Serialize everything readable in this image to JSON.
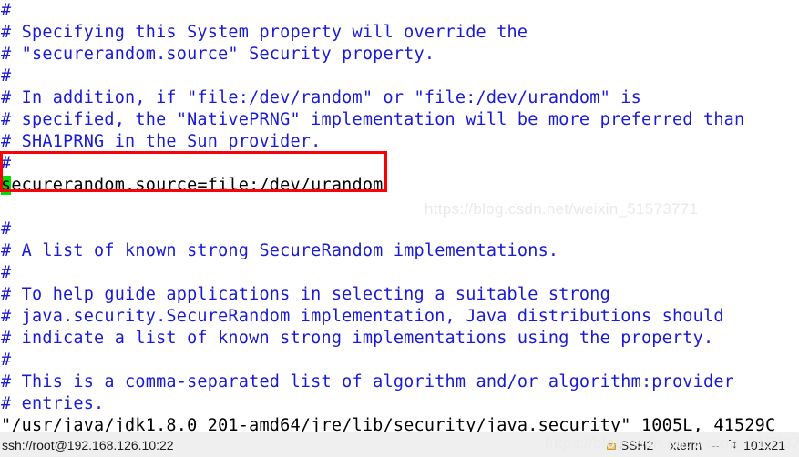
{
  "window": {
    "title": "ssh://root@192.168.126.10:22"
  },
  "terminal": {
    "lines": [
      {
        "type": "comment",
        "text": "#"
      },
      {
        "type": "comment",
        "text": "# Specifying this System property will override the"
      },
      {
        "type": "comment",
        "text": "# \"securerandom.source\" Security property."
      },
      {
        "type": "comment",
        "text": "#"
      },
      {
        "type": "comment",
        "text": "# In addition, if \"file:/dev/random\" or \"file:/dev/urandom\" is"
      },
      {
        "type": "comment",
        "text": "# specified, the \"NativePRNG\" implementation will be more preferred than"
      },
      {
        "type": "comment",
        "text": "# SHA1PRNG in the Sun provider."
      },
      {
        "type": "comment",
        "text": "#"
      },
      {
        "type": "setting",
        "cursor_char": "s",
        "rest": "ecurerandom.source=file:/dev/urandom"
      },
      {
        "type": "blank",
        "text": ""
      },
      {
        "type": "comment",
        "text": "#"
      },
      {
        "type": "comment",
        "text": "# A list of known strong SecureRandom implementations."
      },
      {
        "type": "comment",
        "text": "#"
      },
      {
        "type": "comment",
        "text": "# To help guide applications in selecting a suitable strong"
      },
      {
        "type": "comment",
        "text": "# java.security.SecureRandom implementation, Java distributions should"
      },
      {
        "type": "comment",
        "text": "# indicate a list of known strong implementations using the property."
      },
      {
        "type": "comment",
        "text": "#"
      },
      {
        "type": "comment",
        "text": "# This is a comma-separated list of algorithm and/or algorithm:provider"
      },
      {
        "type": "comment",
        "text": "# entries."
      },
      {
        "type": "file-status",
        "text": "\"/usr/java/jdk1.8.0_201-amd64/jre/lib/security/java.security\" 1005L, 41529C"
      }
    ]
  },
  "annotation": {
    "box_color": "#fb0007",
    "cursor_color": "#00e000",
    "highlighted_line": "securerandom.source=file:/dev/urandom"
  },
  "watermark": {
    "text_main": "https://blog.csdn.net/weixin_51573771",
    "text_bottom": "https://blog.csdn.net/weixin_51573771"
  },
  "status_bar": {
    "connection": "ssh://root@192.168.126.10:22",
    "protocol": "SSH2",
    "emulation": "xterm",
    "dimensions": "101x21",
    "lock_icon": "lock-icon",
    "resize_icon": "resize-icon"
  }
}
